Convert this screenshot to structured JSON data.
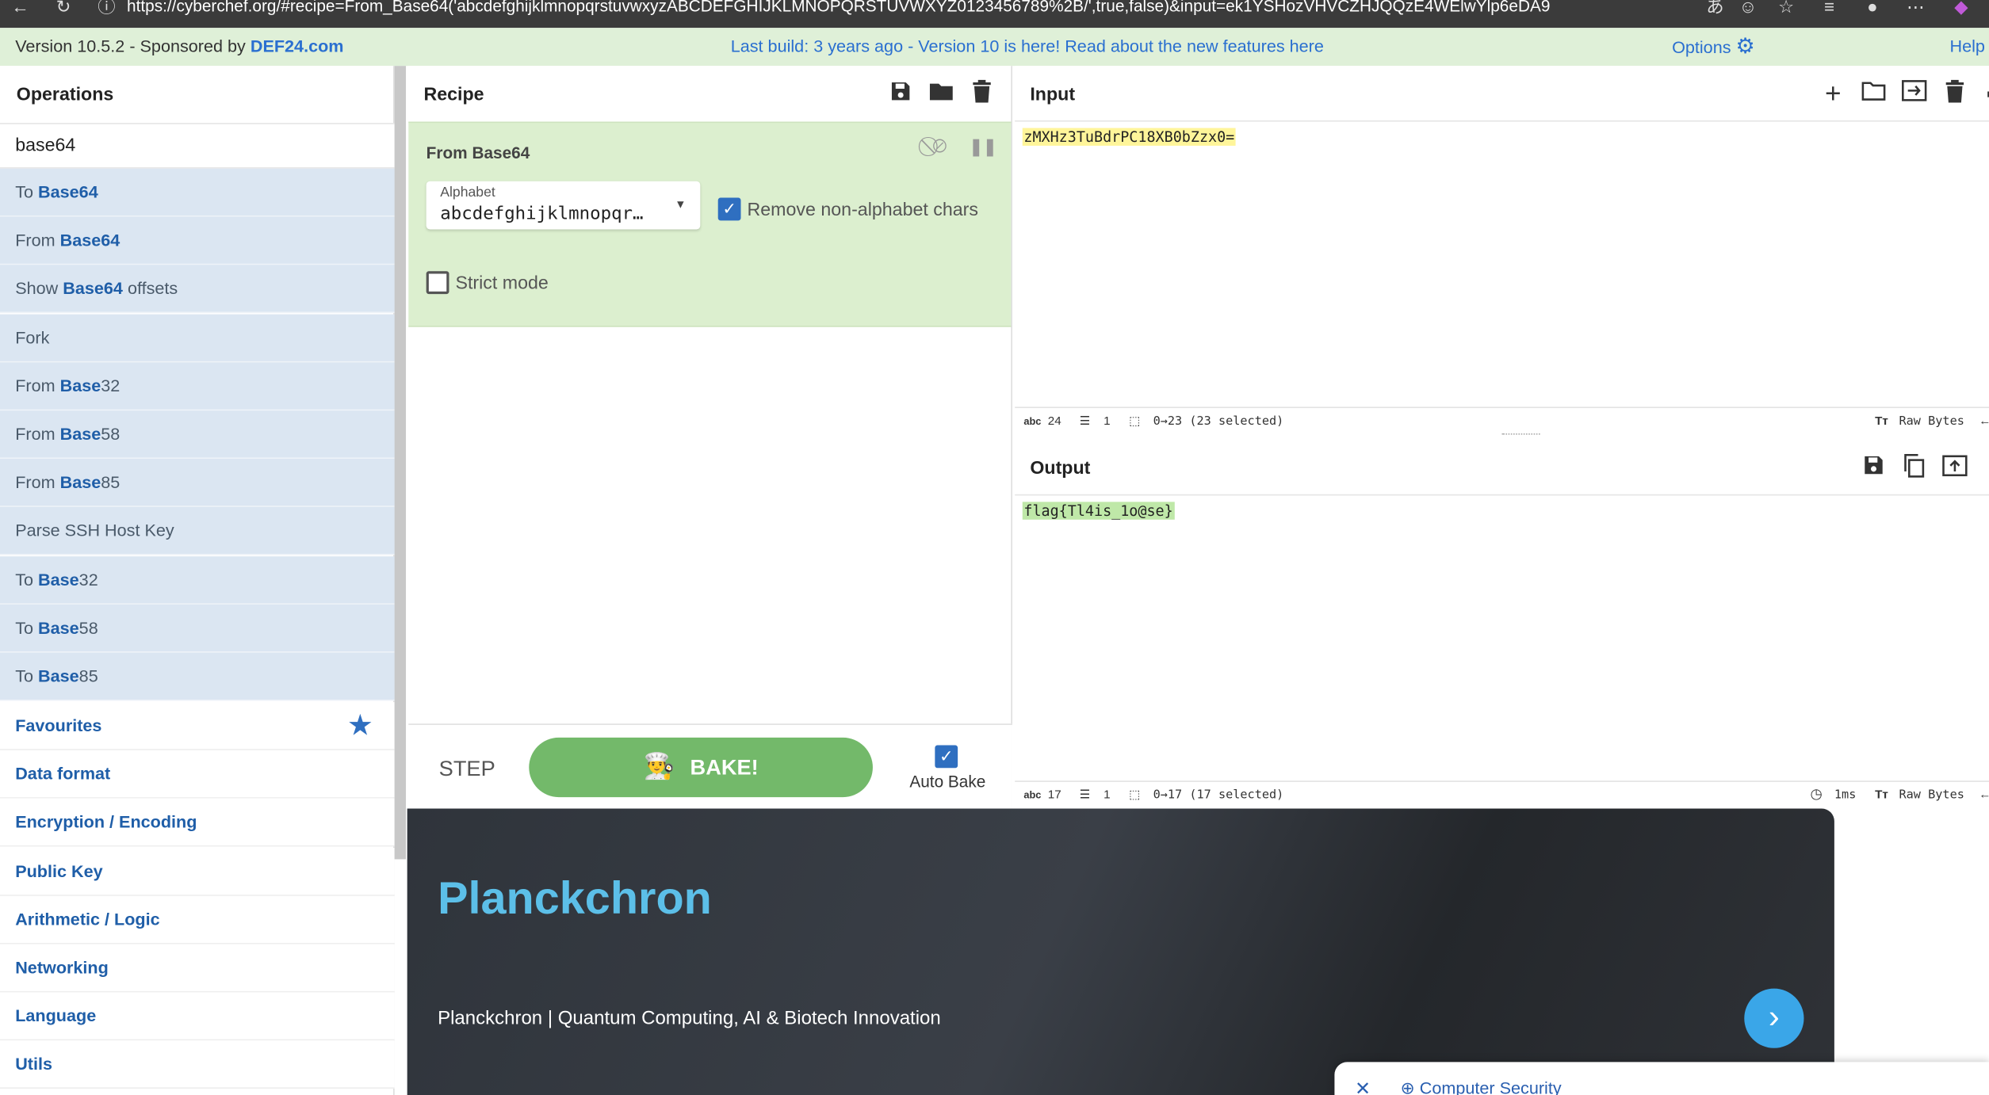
{
  "browser": {
    "url": "https://cyberchef.org/#recipe=From_Base64('abcdefghijklmnopqrstuvwxyzABCDEFGHIJKLMNOPQRSTUVWXYZ0123456789%2B/',true,false)&input=ek1YSHozVHVCZHJQQzE4WElwYlp6eDA9"
  },
  "banner": {
    "version_text": "Version 10.5.2 - Sponsored by ",
    "sponsor": "DEF24.com",
    "build_text": "Last build: 3 years ago - Version 10 is here! Read about the new features ",
    "here": "here",
    "options": "Options",
    "help": "Help"
  },
  "operations": {
    "title": "Operations",
    "search_value": "base64",
    "results": [
      {
        "pre": "To ",
        "bold": "Base64",
        "post": ""
      },
      {
        "pre": "From ",
        "bold": "Base64",
        "post": ""
      },
      {
        "pre": "Show ",
        "bold": "Base64",
        "post": " offsets"
      },
      {
        "pre": "Fork",
        "bold": "",
        "post": ""
      },
      {
        "pre": "From ",
        "bold": "Base",
        "post": "32"
      },
      {
        "pre": "From ",
        "bold": "Base",
        "post": "58"
      },
      {
        "pre": "From ",
        "bold": "Base",
        "post": "85"
      },
      {
        "pre": "Parse SSH Host Key",
        "bold": "",
        "post": ""
      },
      {
        "pre": "To ",
        "bold": "Base",
        "post": "32"
      },
      {
        "pre": "To ",
        "bold": "Base",
        "post": "58"
      },
      {
        "pre": "To ",
        "bold": "Base",
        "post": "85"
      }
    ],
    "categories": [
      "Favourites",
      "Data format",
      "Encryption / Encoding",
      "Public Key",
      "Arithmetic / Logic",
      "Networking",
      "Language",
      "Utils"
    ]
  },
  "recipe": {
    "title": "Recipe",
    "op_name": "From Base64",
    "alphabet_label": "Alphabet",
    "alphabet_value": "abcdefghijklmnopqr…",
    "remove_non_alpha_label": "Remove non-alphabet chars",
    "remove_non_alpha_checked": true,
    "strict_label": "Strict mode",
    "strict_checked": false,
    "step": "STEP",
    "bake": "BAKE!",
    "auto_bake": "Auto Bake"
  },
  "input": {
    "title": "Input",
    "text": "zMXHz3TuBdrPC18XB0bZzx0=",
    "status": {
      "chars": "24",
      "lines": "1",
      "selection": "0→23 (23 selected)",
      "raw": "Raw Bytes"
    }
  },
  "output": {
    "title": "Output",
    "text": "flag{Tl4is_1o@se}",
    "status": {
      "chars": "17",
      "lines": "1",
      "selection": "0→17 (17 selected)",
      "time": "1ms",
      "raw": "Raw Bytes"
    }
  },
  "ad": {
    "title": "Planckchron",
    "subtitle": "Planckchron | Quantum Computing, AI & Biotech Innovation"
  },
  "popup": {
    "label": "Computer Security"
  },
  "colors": {
    "banner_bg": "#dff0d8",
    "op_highlight": "#dbe6f2",
    "recipe_op_bg": "#dcefcf",
    "bake_green": "#73b96a",
    "accent_blue": "#1f5ea8",
    "ad_title": "#5cbfe8"
  }
}
